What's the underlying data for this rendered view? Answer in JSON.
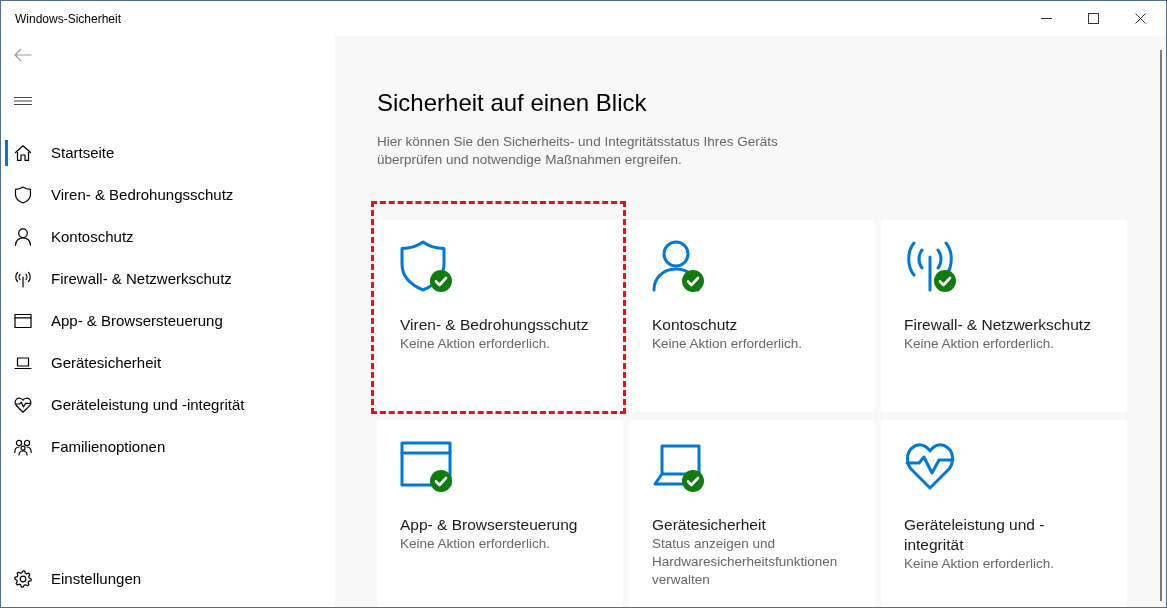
{
  "window": {
    "title": "Windows-Sicherheit"
  },
  "sidebar": {
    "items": [
      {
        "label": "Startseite",
        "selected": true
      },
      {
        "label": "Viren- & Bedrohungsschutz",
        "selected": false
      },
      {
        "label": "Kontoschutz",
        "selected": false
      },
      {
        "label": "Firewall- & Netzwerkschutz",
        "selected": false
      },
      {
        "label": "App- & Browsersteuerung",
        "selected": false
      },
      {
        "label": "Gerätesicherheit",
        "selected": false
      },
      {
        "label": "Geräteleistung und -integrität",
        "selected": false
      },
      {
        "label": "Familienoptionen",
        "selected": false
      }
    ],
    "settings": {
      "label": "Einstellungen"
    }
  },
  "main": {
    "heading": "Sicherheit auf einen Blick",
    "description": "Hier können Sie den Sicherheits- und Integritätsstatus Ihres Geräts überprüfen und notwendige Maßnahmen ergreifen.",
    "cards": [
      {
        "title": "Viren- & Bedrohungsschutz",
        "status": "Keine Aktion erforderlich.",
        "ok": true,
        "highlighted": true
      },
      {
        "title": "Kontoschutz",
        "status": "Keine Aktion erforderlich.",
        "ok": true,
        "highlighted": false
      },
      {
        "title": "Firewall- & Netzwerkschutz",
        "status": "Keine Aktion erforderlich.",
        "ok": true,
        "highlighted": false
      },
      {
        "title": "App- & Browsersteuerung",
        "status": "Keine Aktion erforderlich.",
        "ok": true,
        "highlighted": false
      },
      {
        "title": "Gerätesicherheit",
        "status": "Status anzeigen und Hardwaresicherheitsfunktionen verwalten",
        "ok": true,
        "highlighted": false
      },
      {
        "title": "Geräteleistung und -integrität",
        "status": "Keine Aktion erforderlich.",
        "ok": false,
        "highlighted": false
      }
    ]
  }
}
